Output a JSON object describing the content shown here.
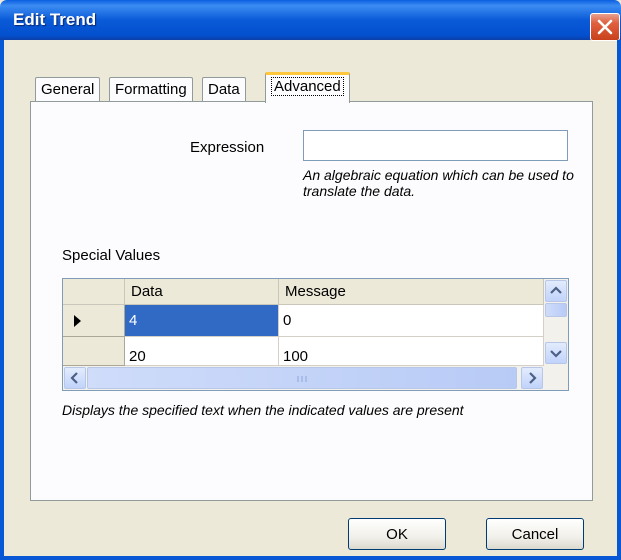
{
  "window": {
    "title": "Edit Trend"
  },
  "tabs": [
    {
      "label": "General"
    },
    {
      "label": "Formatting"
    },
    {
      "label": "Data"
    },
    {
      "label": "Advanced",
      "active": true
    }
  ],
  "advanced": {
    "expression_label": "Expression",
    "expression_value": "",
    "expression_hint": "An algebraic equation which can be used to translate the data.",
    "special_values_label": "Special Values",
    "grid": {
      "columns": [
        "Data",
        "Message"
      ],
      "rows": [
        {
          "data": "4",
          "message": "0",
          "current": true
        },
        {
          "data": "20",
          "message": "100"
        }
      ]
    },
    "grid_hint": "Displays the specified text when the indicated values are present"
  },
  "buttons": {
    "ok": "OK",
    "cancel": "Cancel"
  },
  "colors": {
    "titlebar": "#0a5ad8",
    "selection": "#316ac5",
    "active_tab_accent": "#ffc73c",
    "close_button": "#c9411c"
  }
}
